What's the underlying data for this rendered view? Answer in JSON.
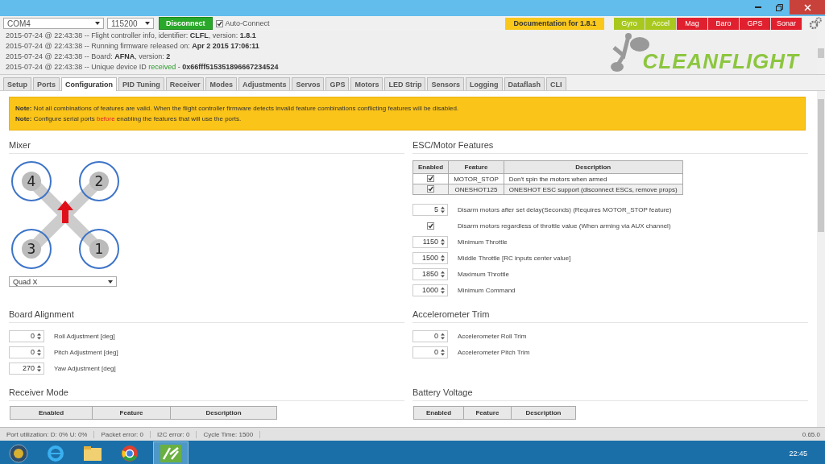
{
  "toolbar": {
    "port": "COM4",
    "baud": "115200",
    "connect_button": "Disconnect",
    "auto_connect": {
      "label": "Auto-Connect",
      "checked": true
    },
    "documentation": "Documentation for 1.8.1",
    "sensors": [
      {
        "name": "Gyro",
        "on": true
      },
      {
        "name": "Accel",
        "on": true
      },
      {
        "name": "Mag",
        "on": false
      },
      {
        "name": "Baro",
        "on": false
      },
      {
        "name": "GPS",
        "on": false
      },
      {
        "name": "Sonar",
        "on": false
      }
    ]
  },
  "log": [
    [
      {
        "text": "2015-07-24 @ 22:43:38 -- Flight controller info, identifier: ",
        "kind": "plain"
      },
      {
        "text": "CLFL",
        "kind": "bold"
      },
      {
        "text": ", version: ",
        "kind": "plain"
      },
      {
        "text": "1.8.1",
        "kind": "bold"
      }
    ],
    [
      {
        "text": "2015-07-24 @ 22:43:38 -- Running firmware released on: ",
        "kind": "plain"
      },
      {
        "text": "Apr 2 2015 17:06:11",
        "kind": "bold"
      }
    ],
    [
      {
        "text": "2015-07-24 @ 22:43:38 -- Board: ",
        "kind": "plain"
      },
      {
        "text": "AFNA",
        "kind": "bold"
      },
      {
        "text": ", version: ",
        "kind": "plain"
      },
      {
        "text": "2",
        "kind": "bold"
      }
    ],
    [
      {
        "text": "2015-07-24 @ 22:43:38 -- Unique device ID ",
        "kind": "plain"
      },
      {
        "text": "received",
        "kind": "ok"
      },
      {
        "text": " - ",
        "kind": "plain"
      },
      {
        "text": "0x66fff515351896667234524",
        "kind": "bold"
      }
    ]
  ],
  "logo": {
    "text": "CLEANFLIGHT"
  },
  "tabs": [
    {
      "label": "Setup",
      "selected": false
    },
    {
      "label": "Ports",
      "selected": false
    },
    {
      "label": "Configuration",
      "selected": true
    },
    {
      "label": "PID Tuning",
      "selected": false
    },
    {
      "label": "Receiver",
      "selected": false
    },
    {
      "label": "Modes",
      "selected": false
    },
    {
      "label": "Adjustments",
      "selected": false
    },
    {
      "label": "Servos",
      "selected": false
    },
    {
      "label": "GPS",
      "selected": false
    },
    {
      "label": "Motors",
      "selected": false
    },
    {
      "label": "LED Strip",
      "selected": false
    },
    {
      "label": "Sensors",
      "selected": false
    },
    {
      "label": "Logging",
      "selected": false
    },
    {
      "label": "Dataflash",
      "selected": false
    },
    {
      "label": "CLI",
      "selected": false
    }
  ],
  "notes": [
    [
      {
        "text": "Note:",
        "kind": "bold"
      },
      {
        "text": " Not all combinations of features are valid. When the flight controller firmware detects invalid feature combinations conflicting features will be disabled.",
        "kind": "plain"
      }
    ],
    [
      {
        "text": "Note:",
        "kind": "bold"
      },
      {
        "text": " Configure serial ports ",
        "kind": "plain"
      },
      {
        "text": "before",
        "kind": "warn"
      },
      {
        "text": " enabling the features that will use the ports.",
        "kind": "plain"
      }
    ]
  ],
  "mixer": {
    "title": "Mixer",
    "motors": [
      "4",
      "2",
      "3",
      "1"
    ],
    "type": "Quad X"
  },
  "esc": {
    "title": "ESC/Motor Features",
    "columns": [
      "Enabled",
      "Feature",
      "Description"
    ],
    "rows": [
      {
        "enabled": true,
        "feature": "MOTOR_STOP",
        "description": "Don't spin the motors when armed"
      },
      {
        "enabled": true,
        "feature": "ONESHOT125",
        "description": "ONESHOT ESC support (disconnect ESCs, remove props)"
      }
    ],
    "settings": [
      {
        "kind": "number",
        "value": "5",
        "label": "Disarm motors after set delay(Seconds) (Requires MOTOR_STOP feature)"
      },
      {
        "kind": "checkbox",
        "checked": true,
        "label": "Disarm motors regardless of throttle value (When arming via AUX channel)"
      },
      {
        "kind": "number",
        "value": "1150",
        "label": "Minimum Throttle"
      },
      {
        "kind": "number",
        "value": "1500",
        "label": "Middle Throttle [RC inputs center value]"
      },
      {
        "kind": "number",
        "value": "1850",
        "label": "Maximum Throttle"
      },
      {
        "kind": "number",
        "value": "1000",
        "label": "Minimum Command"
      }
    ]
  },
  "board_alignment": {
    "title": "Board Alignment",
    "fields": [
      {
        "value": "0",
        "label": "Roll Adjustment [deg]"
      },
      {
        "value": "0",
        "label": "Pitch Adjustment [deg]"
      },
      {
        "value": "270",
        "label": "Yaw Adjustment [deg]"
      }
    ]
  },
  "accelerometer_trim": {
    "title": "Accelerometer Trim",
    "fields": [
      {
        "value": "0",
        "label": "Accelerometer Roll Trim"
      },
      {
        "value": "0",
        "label": "Accelerometer Pitch Trim"
      }
    ]
  },
  "receiver_mode": {
    "title": "Receiver Mode",
    "columns": [
      "Enabled",
      "Feature",
      "Description"
    ]
  },
  "battery_voltage": {
    "title": "Battery Voltage",
    "columns": [
      "Enabled",
      "Feature",
      "Description"
    ]
  },
  "status_bar": {
    "items": [
      "Port utilization: D: 0% U: 0%",
      "Packet error: 0",
      "I2C error: 0",
      "Cycle Time: 1500"
    ],
    "version": "0.65.0"
  },
  "taskbar": {
    "clock": "22:45"
  }
}
